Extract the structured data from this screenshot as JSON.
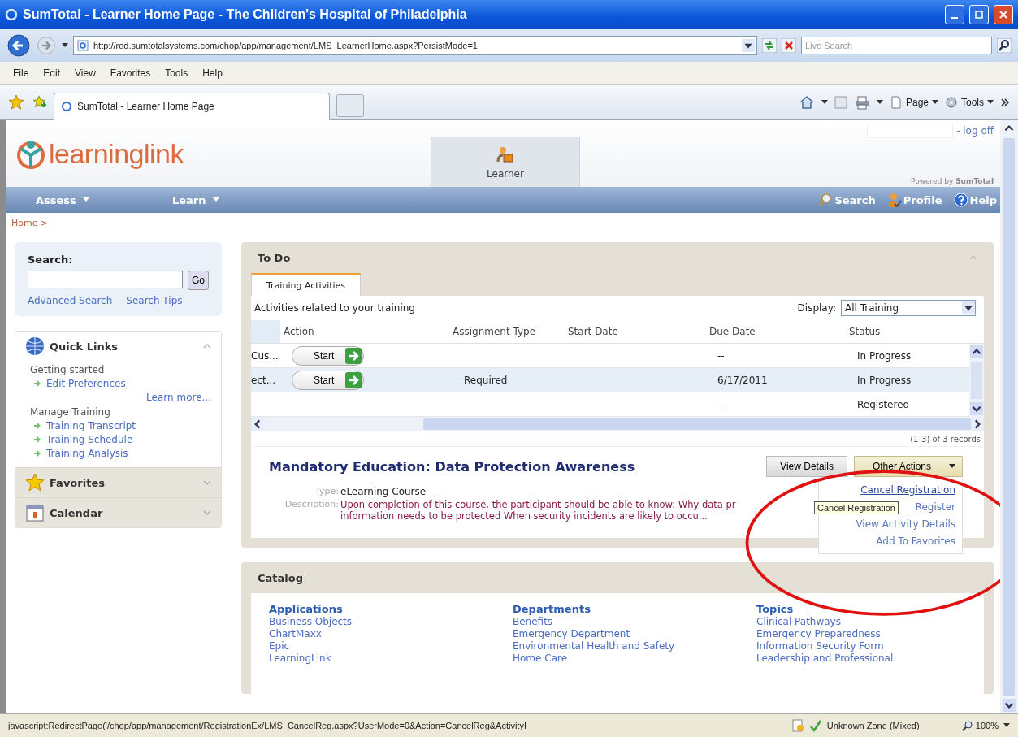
{
  "window": {
    "title": "SumTotal - Learner Home Page - The Children's Hospital of Philadelphia"
  },
  "address_bar": {
    "url": "http://rod.sumtotalsystems.com/chop/app/management/LMS_LearnerHome.aspx?PersistMode=1",
    "search_placeholder": "Live Search"
  },
  "menu_bar": [
    "File",
    "Edit",
    "View",
    "Favorites",
    "Tools",
    "Help"
  ],
  "browser_tab": {
    "title": "SumTotal - Learner Home Page"
  },
  "command_bar": [
    {
      "kind": "page",
      "label": "Page"
    },
    {
      "kind": "tools",
      "label": "Tools"
    }
  ],
  "header": {
    "logo": "learninglink",
    "role_tab": "Learner",
    "log_off": "- log off",
    "powered_by": "Powered by",
    "powered_brand": "SumTotal"
  },
  "nav": {
    "menus": [
      "Assess",
      "Learn"
    ],
    "links": [
      {
        "kind": "search",
        "label": "Search"
      },
      {
        "kind": "profile",
        "label": "Profile"
      },
      {
        "kind": "help",
        "label": "Help"
      }
    ]
  },
  "breadcrumb": "Home >",
  "sidebar": {
    "search": {
      "title": "Search:",
      "button": "Go",
      "links": [
        "Advanced Search",
        "Search Tips"
      ]
    },
    "panels": [
      {
        "kind": "quick_links",
        "title": "Quick Links",
        "expanded": true,
        "groups": [
          {
            "title": "Getting started",
            "links": [
              "Edit Preferences"
            ],
            "more": "Learn more..."
          },
          {
            "title": "Manage Training",
            "links": [
              "Training Transcript",
              "Training Schedule",
              "Training Analysis"
            ]
          }
        ]
      },
      {
        "kind": "favorites",
        "title": "Favorites",
        "expanded": false
      },
      {
        "kind": "calendar",
        "title": "Calendar",
        "expanded": false
      }
    ]
  },
  "todo": {
    "title": "To Do",
    "tabs": [
      {
        "label": "Training Activities",
        "selected": true
      }
    ],
    "caption": "Activities related to your training",
    "display_label": "Display:",
    "display_value": "All Training",
    "columns": [
      "Action",
      "Assignment Type",
      "Start Date",
      "Due Date",
      "Status"
    ],
    "rows": [
      {
        "column_1": "Cus...",
        "action": "Start",
        "due_date": "--",
        "status": "In Progress",
        "selected": false
      },
      {
        "column_1": "ect...",
        "action": "Start",
        "assignment_type": "Required",
        "due_date": "6/17/2011",
        "status": "In Progress",
        "selected": true
      },
      {
        "due_date": "--",
        "status": "Registered",
        "selected": false
      }
    ],
    "record_count": "(1-3) of 3 records",
    "detail": {
      "title": "Mandatory Education: Data Protection Awareness",
      "view_details": "View Details",
      "other_actions": "Other Actions",
      "type_label": "Type:",
      "type_value": "eLearning Course",
      "description_label": "Description:",
      "description_lines": [
        "Upon completion of this course, the participant should be able to know: Why data pr",
        "information needs to be protected When security incidents are likely to occu..."
      ],
      "actions_menu": [
        {
          "label": "Cancel Registration",
          "hovered": true
        },
        {
          "label": "Register",
          "hovered": false
        },
        {
          "label": "View Activity Details",
          "hovered": false
        },
        {
          "label": "Add To Favorites",
          "hovered": false
        }
      ],
      "tooltip": "Cancel Registration"
    }
  },
  "catalog": {
    "title": "Catalog",
    "columns": [
      {
        "heading": "Applications",
        "items": [
          "Business Objects",
          "ChartMaxx",
          "Epic",
          "LearningLink"
        ]
      },
      {
        "heading": "Departments",
        "items": [
          "Benefits",
          "Emergency Department",
          "Environmental Health and Safety",
          "Home Care"
        ]
      },
      {
        "heading": "Topics",
        "items": [
          "Clinical Pathways",
          "Emergency Preparedness",
          "Information Security Form",
          "Leadership and Professional"
        ]
      }
    ]
  },
  "status_bar": {
    "text": "javascript:RedirectPage('/chop/app/management/RegistrationEx/LMS_CancelReg.aspx?UserMode=0&Action=CancelReg&ActivityI",
    "zone": "Unknown Zone (Mixed)",
    "zoom": "100%"
  }
}
